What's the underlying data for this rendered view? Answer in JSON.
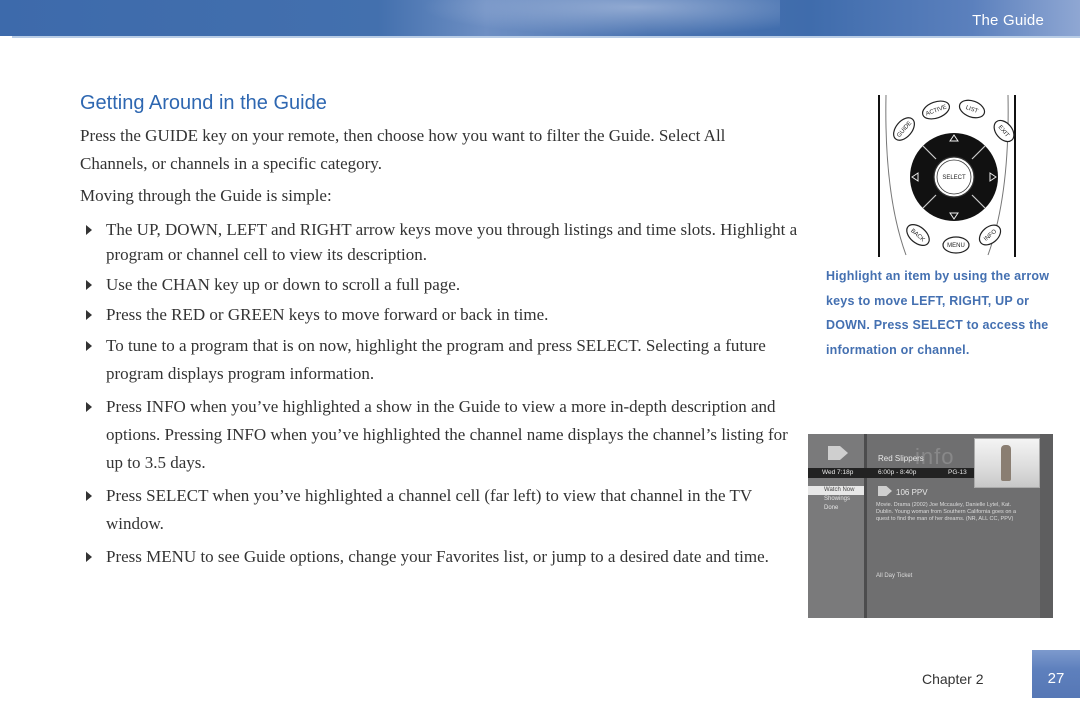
{
  "header": {
    "section_title": "The Guide"
  },
  "content": {
    "heading": "Getting Around in the Guide",
    "intro": "Press the GUIDE key on your remote, then choose how you want to filter the Guide. Select All Channels, or channels in a specific category.",
    "intro2": "Moving through the Guide is simple:",
    "bullets": [
      "The UP, DOWN, LEFT and RIGHT arrow keys move you through listings and time slots. Highlight a program or channel cell to view its description.",
      "Use the CHAN key up or down to scroll a full page.",
      "Press the RED or GREEN keys to move forward or back in time.",
      "To tune to a program that is on now, highlight the program and press SELECT. Selecting a future program displays program information.",
      "Press INFO when you’ve highlighted a show in the Guide to view a more in-depth description and options. Pressing INFO when you’ve highlighted the channel name displays the channel’s listing for up to 3.5 days.",
      "Press SELECT when you’ve highlighted a channel cell (far left) to view that channel in the TV window.",
      "Press MENU to see Guide options, change your Favorites list, or jump to a desired date and time."
    ]
  },
  "remote": {
    "buttons": {
      "guide": "GUIDE",
      "active": "ACTIVE",
      "list": "LIST",
      "exit": "EXIT",
      "select": "SELECT",
      "back": "BACK",
      "menu": "MENU",
      "info": "INFO"
    }
  },
  "caption": "Highlight an item by using the arrow keys to move LEFT, RIGHT, UP or DOWN. Press SELECT to access the information or channel.",
  "tv_screen": {
    "program_title": "Red Slippers",
    "info_watermark": "info",
    "day_time": "Wed 7:18p",
    "time_range": "6:00p - 8:40p",
    "rating": "PG-13",
    "menu_items": [
      "Watch Now",
      "Showings",
      "Done"
    ],
    "channel": "106 PPV",
    "description": "Movie. Drama (2002) Joe Mccauley, Danielle Lytel, Kat. Dublin. Young woman from Southern California goes on a quest to find the man of her dreams. (NR, ALL CC, PPV)",
    "ticket": "All Day Ticket"
  },
  "footer": {
    "chapter": "Chapter 2",
    "page_number": "27"
  },
  "colors": {
    "accent_blue": "#2e67b1",
    "caption_blue": "#4470b1",
    "header_blue": "#3d6aab"
  }
}
